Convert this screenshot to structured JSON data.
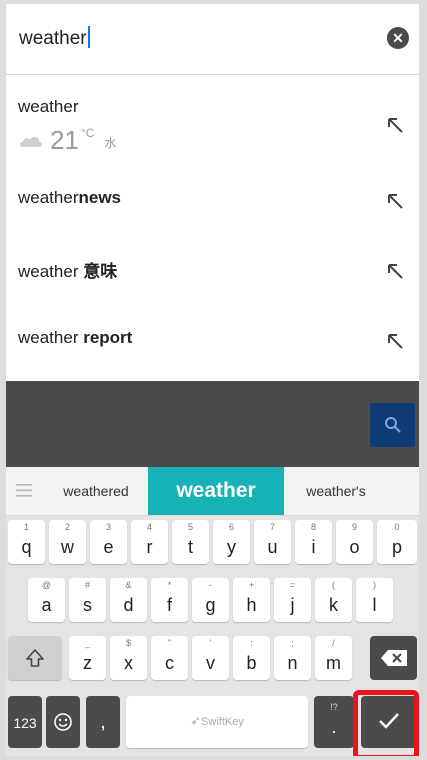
{
  "search": {
    "query": "weather"
  },
  "suggestions": [
    {
      "prefix": "weather",
      "bold": "",
      "weather": {
        "temp": "21",
        "unit": "°C",
        "day": "水"
      }
    },
    {
      "prefix": "weather",
      "bold": "news"
    },
    {
      "prefix": "weather ",
      "bold": "意味"
    },
    {
      "prefix": "weather ",
      "bold": "report"
    }
  ],
  "predictions": {
    "left": "weathered",
    "center": "weather",
    "right": "weather's"
  },
  "keyboard": {
    "row1": [
      {
        "hint": "1",
        "label": "q"
      },
      {
        "hint": "2",
        "label": "w"
      },
      {
        "hint": "3",
        "label": "e"
      },
      {
        "hint": "4",
        "label": "r"
      },
      {
        "hint": "5",
        "label": "t"
      },
      {
        "hint": "6",
        "label": "y"
      },
      {
        "hint": "7",
        "label": "u"
      },
      {
        "hint": "8",
        "label": "i"
      },
      {
        "hint": "9",
        "label": "o"
      },
      {
        "hint": "0",
        "label": "p"
      }
    ],
    "row2": [
      {
        "hint": "@",
        "label": "a"
      },
      {
        "hint": "#",
        "label": "s"
      },
      {
        "hint": "&",
        "label": "d"
      },
      {
        "hint": "*",
        "label": "f"
      },
      {
        "hint": "-",
        "label": "g"
      },
      {
        "hint": "+",
        "label": "h"
      },
      {
        "hint": "=",
        "label": "j"
      },
      {
        "hint": "(",
        "label": "k"
      },
      {
        "hint": ")",
        "label": "l"
      }
    ],
    "row3": [
      {
        "hint": "_",
        "label": "z"
      },
      {
        "hint": "$",
        "label": "x"
      },
      {
        "hint": "\"",
        "label": "c"
      },
      {
        "hint": "'",
        "label": "v"
      },
      {
        "hint": ":",
        "label": "b"
      },
      {
        "hint": ";",
        "label": "n"
      },
      {
        "hint": "/",
        "label": "m"
      }
    ],
    "numbers_label": "123",
    "comma_label": ",",
    "space_label": "SwiftKey",
    "period_hint": "!?",
    "period_label": "."
  },
  "colors": {
    "accent": "#16b2b5",
    "highlight": "#e8141c",
    "search_button": "#0e3b73"
  }
}
